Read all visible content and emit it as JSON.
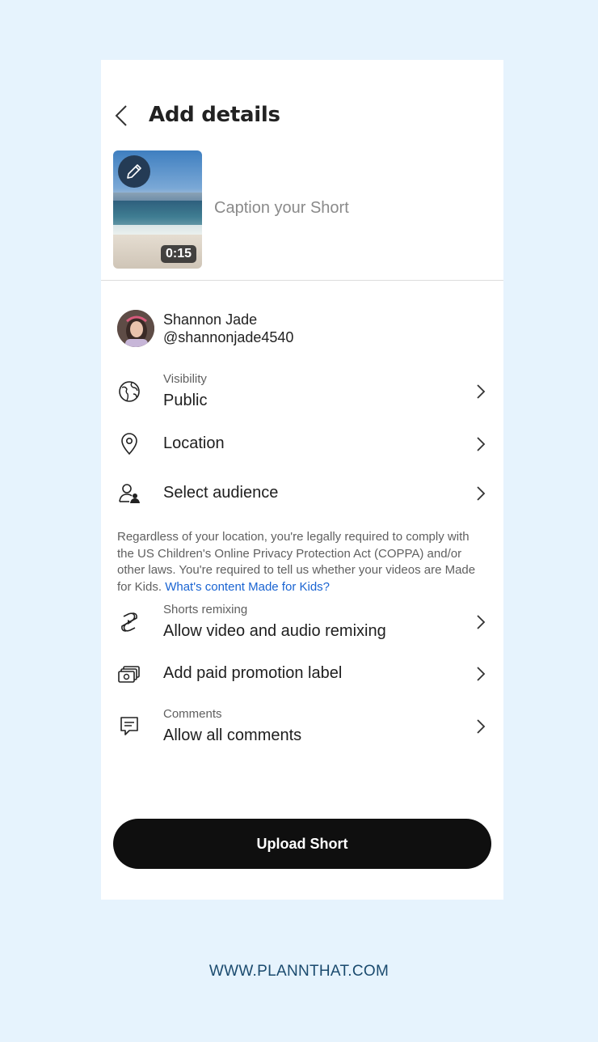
{
  "header": {
    "title": "Add details"
  },
  "video": {
    "duration": "0:15",
    "caption_placeholder": "Caption your Short"
  },
  "account": {
    "name": "Shannon Jade",
    "handle": "@shannonjade4540"
  },
  "settings": {
    "visibility": {
      "label": "Visibility",
      "value": "Public"
    },
    "location": {
      "value": "Location"
    },
    "audience": {
      "value": "Select audience"
    },
    "notice": {
      "text": "Regardless of your location, you're legally required to comply with the US Children's Online Privacy Protection Act (COPPA) and/or other laws. You're required to tell us whether your videos are Made for Kids.",
      "link": "What's content Made for Kids?"
    },
    "remixing": {
      "label": "Shorts remixing",
      "value": "Allow video and audio remixing"
    },
    "promotion": {
      "value": "Add paid promotion label"
    },
    "comments": {
      "label": "Comments",
      "value": "Allow all comments"
    }
  },
  "actions": {
    "upload_label": "Upload Short"
  },
  "footer": {
    "website": "WWW.PLANNTHAT.COM"
  },
  "colors": {
    "background": "#e6f3fd",
    "button": "#0f0f0f",
    "link": "#1a64d2"
  }
}
